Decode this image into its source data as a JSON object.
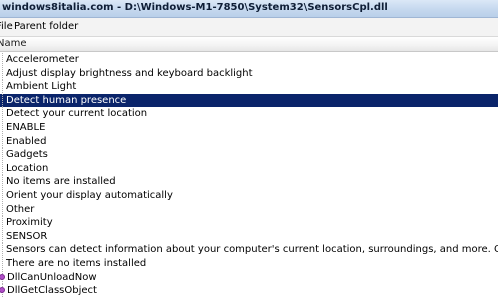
{
  "window": {
    "title": "windows8italia.com - D:\\Windows-M1-7850\\System32\\SensorsCpl.dll"
  },
  "menu": {
    "file_label": "File",
    "parent_folder_label": "Parent folder"
  },
  "list": {
    "column_header": "Name",
    "selected_index": 3,
    "items": [
      {
        "label": "Accelerometer",
        "icon": "none"
      },
      {
        "label": "Adjust display brightness and keyboard backlight",
        "icon": "none"
      },
      {
        "label": "Ambient Light",
        "icon": "none"
      },
      {
        "label": "Detect human presence",
        "icon": "none"
      },
      {
        "label": "Detect your current location",
        "icon": "none"
      },
      {
        "label": "ENABLE",
        "icon": "none"
      },
      {
        "label": "Enabled",
        "icon": "none"
      },
      {
        "label": "Gadgets",
        "icon": "none"
      },
      {
        "label": "Location",
        "icon": "none"
      },
      {
        "label": "No items are installed",
        "icon": "none"
      },
      {
        "label": "Orient your display automatically",
        "icon": "none"
      },
      {
        "label": "Other",
        "icon": "none"
      },
      {
        "label": "Proximity",
        "icon": "none"
      },
      {
        "label": "SENSOR",
        "icon": "none"
      },
      {
        "label": "Sensors can detect information about your computer's current location, surroundings, and more. Once a sensor is enabled",
        "icon": "none"
      },
      {
        "label": "There are no items installed",
        "icon": "none"
      },
      {
        "label": "DllCanUnloadNow",
        "icon": "export-function-icon"
      },
      {
        "label": "DllGetClassObject",
        "icon": "export-function-icon"
      }
    ]
  },
  "colors": {
    "selection": "#0a246a",
    "function_icon": "#b04fc8"
  }
}
